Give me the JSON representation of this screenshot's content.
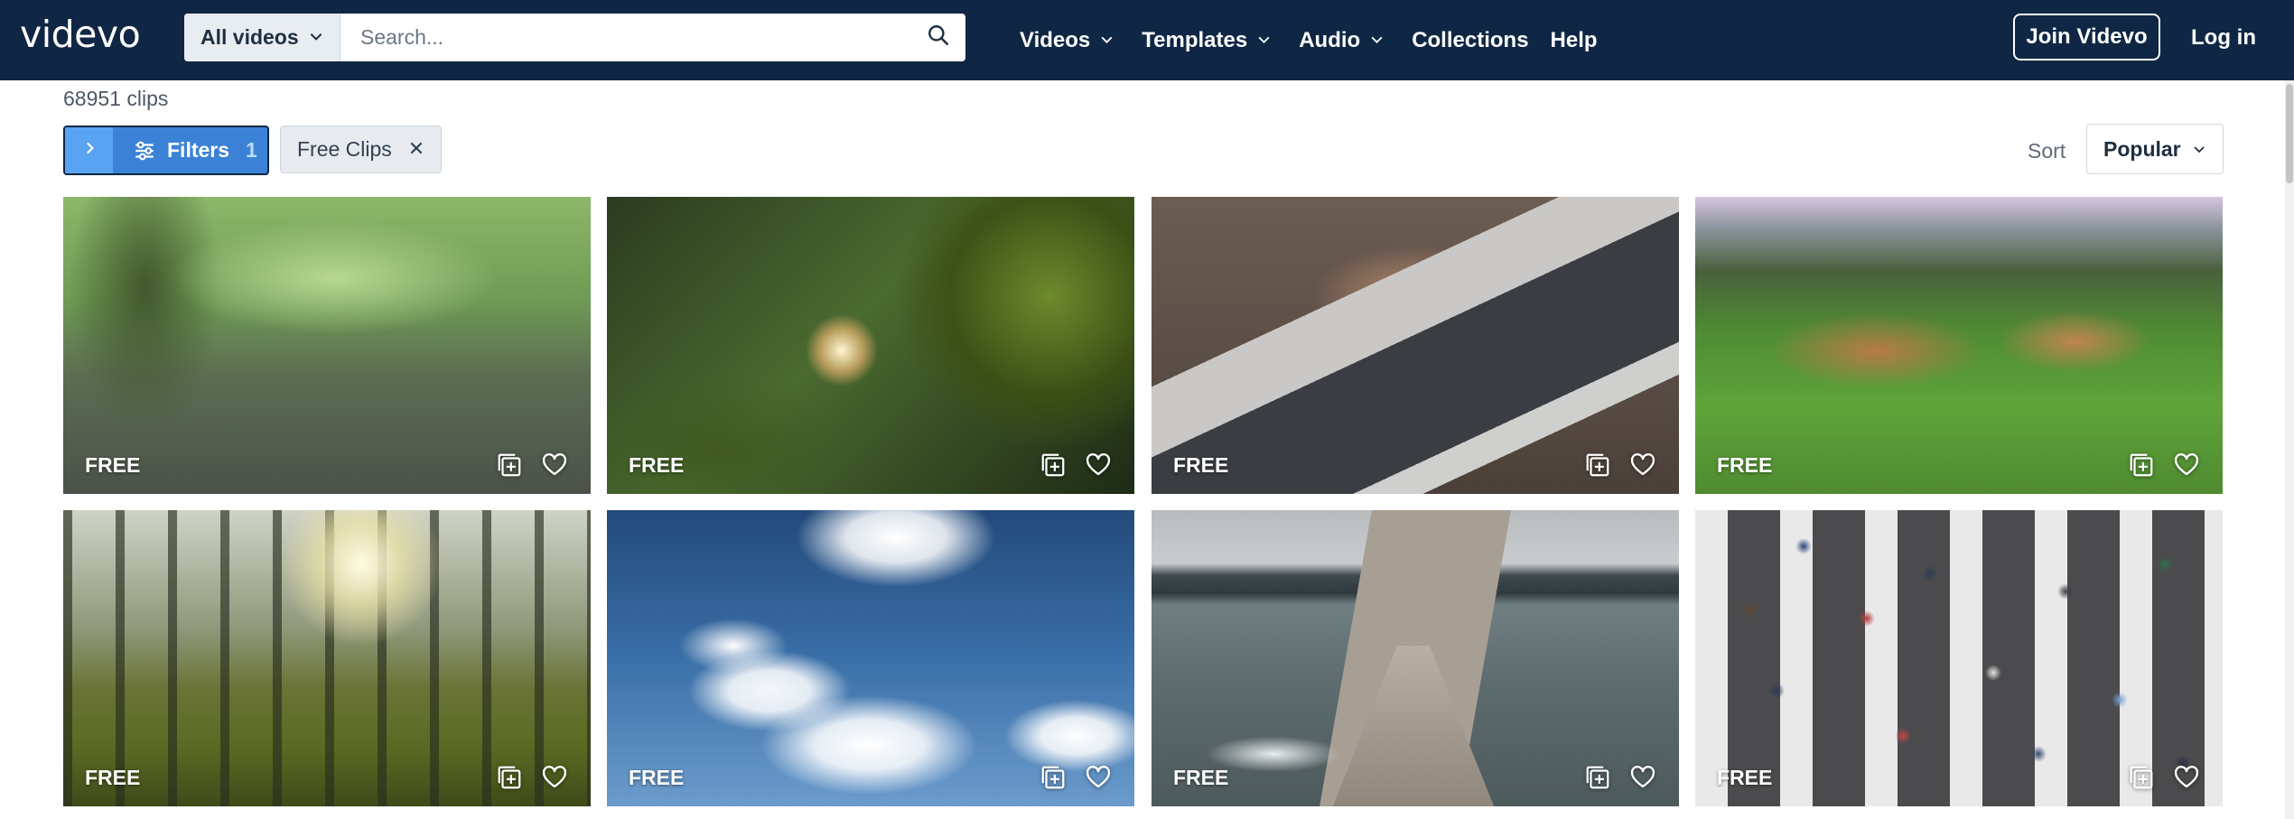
{
  "header": {
    "logo": "videvo",
    "search": {
      "scope_label": "All videos",
      "placeholder": "Search..."
    },
    "nav": [
      {
        "label": "Videos",
        "has_menu": true
      },
      {
        "label": "Templates",
        "has_menu": true
      },
      {
        "label": "Audio",
        "has_menu": true
      },
      {
        "label": "Collections",
        "has_menu": false
      },
      {
        "label": "Help",
        "has_menu": false
      }
    ],
    "join_label": "Join Videvo",
    "login_label": "Log in"
  },
  "toolbar": {
    "clip_count": "68951 clips",
    "filters_label": "Filters",
    "filters_count": "1",
    "chip_label": "Free Clips",
    "sort_label": "Sort",
    "sort_value": "Popular"
  },
  "clips": [
    {
      "badge": "FREE",
      "scene": "rain-puddle-forest"
    },
    {
      "badge": "FREE",
      "scene": "sunlight-through-leaves"
    },
    {
      "badge": "FREE",
      "scene": "typing-on-laptop"
    },
    {
      "badge": "FREE",
      "scene": "lionesses-walking"
    },
    {
      "badge": "FREE",
      "scene": "grass-sunlight-forest"
    },
    {
      "badge": "FREE",
      "scene": "clouds-blue-sky"
    },
    {
      "badge": "FREE",
      "scene": "wooden-pier-lake"
    },
    {
      "badge": "FREE",
      "scene": "crosswalk-crowd"
    }
  ],
  "colors": {
    "header_bg": "#0f2744",
    "filters_bg": "#3b82d6",
    "filters_accent": "#5aa3f0"
  },
  "icons": {
    "search": "search-icon",
    "add_to_collection": "add-to-collection-icon",
    "favorite": "heart-icon",
    "close": "close-icon",
    "chevron": "chevron-down-icon",
    "filters": "sliders-icon"
  }
}
